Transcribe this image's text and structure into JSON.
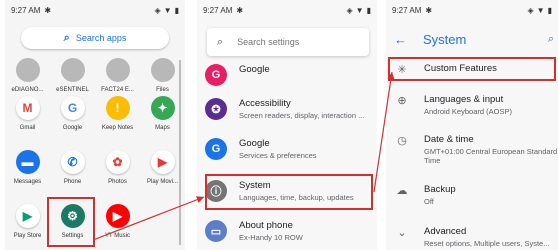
{
  "status_bar": {
    "time": "9:27 AM",
    "notif_icon": "notification-icon"
  },
  "app_drawer": {
    "search_label": "Search apps",
    "rows": [
      [
        {
          "label": "eDIAGNO...",
          "color": "#9e9e9e",
          "glyph": "",
          "faded": true
        },
        {
          "label": "eSENTINEL",
          "color": "#9e9e9e",
          "glyph": "",
          "faded": true
        },
        {
          "label": "FACT24 E...",
          "color": "#9e9e9e",
          "glyph": "",
          "faded": true
        },
        {
          "label": "Files",
          "color": "#9e9e9e",
          "glyph": "",
          "faded": true
        }
      ],
      [
        {
          "label": "Gmail",
          "color": "#ffffff",
          "glyph": "M",
          "glyph_color": "#ea4335"
        },
        {
          "label": "Google",
          "color": "#ffffff",
          "glyph": "G",
          "glyph_color": "#4285f4"
        },
        {
          "label": "Keep Notes",
          "color": "#fbbc04",
          "glyph": "!",
          "glyph_color": "#ffffff"
        },
        {
          "label": "Maps",
          "color": "#34a853",
          "glyph": "✦",
          "glyph_color": "#ffffff"
        }
      ],
      [
        {
          "label": "Messages",
          "color": "#1a73e8",
          "glyph": "▬",
          "glyph_color": "#ffffff"
        },
        {
          "label": "Phone",
          "color": "#ffffff",
          "glyph": "✆",
          "glyph_color": "#1a73e8"
        },
        {
          "label": "Photos",
          "color": "#ffffff",
          "glyph": "✿",
          "glyph_color": "#ea4335"
        },
        {
          "label": "Play Movi...",
          "color": "#ffffff",
          "glyph": "▶",
          "glyph_color": "#e53935"
        }
      ],
      [
        {
          "label": "Play Store",
          "color": "#ffffff",
          "glyph": "▶",
          "glyph_color": "#00a173"
        },
        {
          "label": "Settings",
          "color": "#1b7a66",
          "glyph": "⚙",
          "glyph_color": "#ffffff"
        },
        {
          "label": "YT Music",
          "color": "#ff0000",
          "glyph": "▶",
          "glyph_color": "#ffffff"
        },
        {
          "label": "",
          "color": "transparent",
          "glyph": "",
          "glyph_color": "#ffffff"
        }
      ]
    ]
  },
  "settings": {
    "search_placeholder": "Search settings",
    "items": [
      {
        "title": "Google",
        "subtitle": "",
        "color": "#e91e63",
        "icon": "google-icon"
      },
      {
        "title": "Accessibility",
        "subtitle": "Screen readers, display, interaction ...",
        "color": "#5c2d91",
        "icon": "accessibility-icon"
      },
      {
        "title": "Google",
        "subtitle": "Services & preferences",
        "color": "#1a73e8",
        "icon": "google-g-icon"
      },
      {
        "title": "System",
        "subtitle": "Languages, time, backup, updates",
        "color": "#757575",
        "icon": "info-icon"
      },
      {
        "title": "About phone",
        "subtitle": "Ex-Handy 10 ROW",
        "color": "#5b7fc7",
        "icon": "phone-icon"
      }
    ]
  },
  "system": {
    "title": "System",
    "items": [
      {
        "title": "Custom Features",
        "subtitle": "",
        "icon": "asterisk-icon"
      },
      {
        "title": "Languages & input",
        "subtitle": "Android Keyboard (AOSP)",
        "icon": "globe-icon"
      },
      {
        "title": "Date & time",
        "subtitle": "GMT+01:00 Central European Standard Time",
        "icon": "clock-icon"
      },
      {
        "title": "Backup",
        "subtitle": "Off",
        "icon": "cloud-icon"
      },
      {
        "title": "Advanced",
        "subtitle": "Reset options, Multiple users, Syste...",
        "icon": "chevron-down-icon"
      }
    ]
  },
  "colors": {
    "accent": "#1a73e8",
    "highlight": "#d32f2f"
  }
}
